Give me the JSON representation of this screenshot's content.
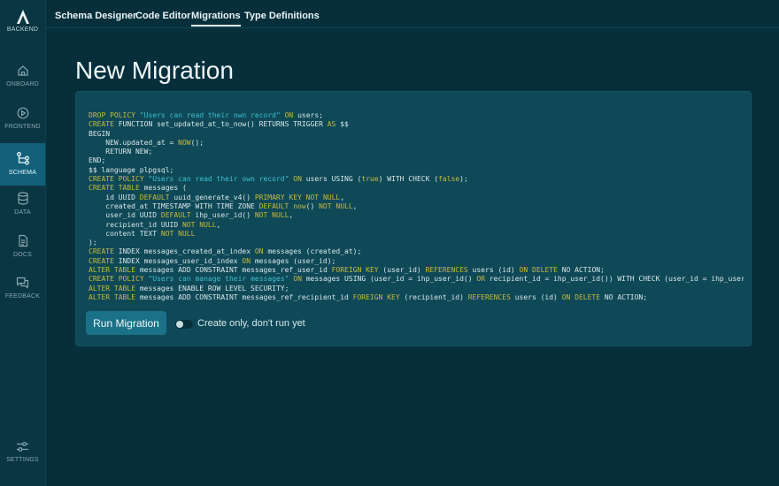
{
  "app": {
    "brand_label": "BACKEND"
  },
  "sidebar": {
    "items": [
      {
        "label": "ONBOARD",
        "icon": "home-icon"
      },
      {
        "label": "FRONTEND",
        "icon": "play-icon"
      },
      {
        "label": "SCHEMA",
        "icon": "schema-icon",
        "active": true
      },
      {
        "label": "DATA",
        "icon": "database-icon"
      },
      {
        "label": "DOCS",
        "icon": "document-icon"
      },
      {
        "label": "FEEDBACK",
        "icon": "chat-icon"
      }
    ],
    "settings_label": "SETTINGS"
  },
  "topnav": {
    "tabs": [
      {
        "label": "Schema Designer"
      },
      {
        "label": "Code Editor"
      },
      {
        "label": "Migrations",
        "active": true
      },
      {
        "label": "Type Definitions"
      }
    ]
  },
  "page": {
    "title": "New Migration"
  },
  "migration": {
    "code_lines": [
      "DROP POLICY \"Users can read their own record\" ON users;",
      "CREATE FUNCTION set_updated_at_to_now() RETURNS TRIGGER AS $$",
      "BEGIN",
      "    NEW.updated_at = NOW();",
      "    RETURN NEW;",
      "END;",
      "$$ language plpgsql;",
      "CREATE POLICY \"Users can read their own record\" ON users USING (true) WITH CHECK (false);",
      "CREATE TABLE messages (",
      "    id UUID DEFAULT uuid_generate_v4() PRIMARY KEY NOT NULL,",
      "    created_at TIMESTAMP WITH TIME ZONE DEFAULT now() NOT NULL,",
      "    user_id UUID DEFAULT ihp_user_id() NOT NULL,",
      "    recipient_id UUID NOT NULL,",
      "    content TEXT NOT NULL",
      ");",
      "CREATE INDEX messages_created_at_index ON messages (created_at);",
      "CREATE INDEX messages_user_id_index ON messages (user_id);",
      "ALTER TABLE messages ADD CONSTRAINT messages_ref_user_id FOREIGN KEY (user_id) REFERENCES users (id) ON DELETE NO ACTION;",
      "CREATE POLICY \"Users can manage their messages\" ON messages USING (user_id = ihp_user_id() OR recipient_id = ihp_user_id()) WITH CHECK (user_id = ihp_user_id());",
      "ALTER TABLE messages ENABLE ROW LEVEL SECURITY;",
      "ALTER TABLE messages ADD CONSTRAINT messages_ref_recipient_id FOREIGN KEY (recipient_id) REFERENCES users (id) ON DELETE NO ACTION;"
    ],
    "run_button_label": "Run Migration",
    "create_only_label": "Create only, don't run yet",
    "create_only_enabled": false
  },
  "colors": {
    "background": "#072f3b",
    "sidebar": "#0a3542",
    "active_nav": "#13607a",
    "panel": "#0f4957",
    "button": "#1a7288",
    "keyword": "#c8b93e",
    "string": "#3fbfcf"
  }
}
